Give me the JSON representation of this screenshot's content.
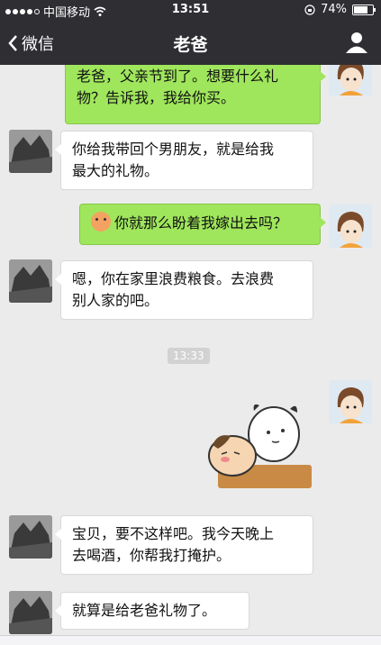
{
  "status_bar": {
    "carrier": "中国移动",
    "time": "13:51",
    "battery": "74%",
    "battery_level": 0.74
  },
  "nav": {
    "back_label": "微信",
    "title": "老爸",
    "back_icon": "chevron-left-icon",
    "profile_icon": "person-icon"
  },
  "messages": [
    {
      "side": "right",
      "text_line1": "老爸，父亲节到了。想要什么礼",
      "text_line2": "物？告诉我，我给你买。"
    },
    {
      "side": "left",
      "text_line1": "你给我带回个男朋友，就是给我",
      "text_line2": "最大的礼物。"
    },
    {
      "side": "right",
      "text": "你就那么盼着我嫁出去吗？"
    },
    {
      "side": "left",
      "text_line1": "嗯，你在家里浪费粮食。去浪费",
      "text_line2": "别人家的吧。"
    },
    {
      "side": "left",
      "text_line1": "宝贝，要不这样吧。我今天晚上",
      "text_line2": "去喝酒，你帮我打掩护。"
    },
    {
      "side": "left",
      "text": "就算是给老爸礼物了。"
    }
  ],
  "timestamp": "13:33",
  "colors": {
    "nav_bg": "#2e2e33",
    "chat_bg": "#ebebeb",
    "bubble_me": "#9fe65c",
    "bubble_other": "#ffffff"
  }
}
